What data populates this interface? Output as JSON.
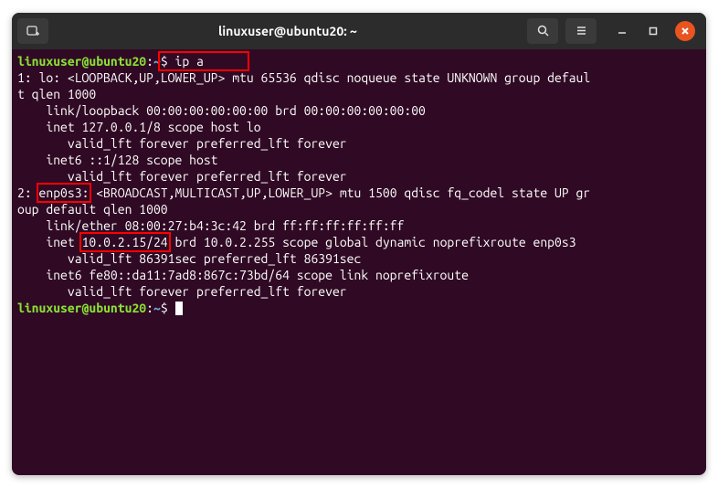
{
  "window": {
    "title": "linuxuser@ubuntu20: ~"
  },
  "prompt": {
    "user_host": "linuxuser@ubuntu20",
    "colon": ":",
    "path": "~",
    "symbol": "$"
  },
  "command": "ip a",
  "output": {
    "l1": "1: lo: <LOOPBACK,UP,LOWER_UP> mtu 65536 qdisc noqueue state UNKNOWN group defaul",
    "l2": "t qlen 1000",
    "l3": "    link/loopback 00:00:00:00:00:00 brd 00:00:00:00:00:00",
    "l4": "    inet 127.0.0.1/8 scope host lo",
    "l5": "       valid_lft forever preferred_lft forever",
    "l6": "    inet6 ::1/128 scope host ",
    "l7": "       valid_lft forever preferred_lft forever",
    "l8a": "2: ",
    "l8b": "enp0s3:",
    "l8c": " <BROADCAST,MULTICAST,UP,LOWER_UP> mtu 1500 qdisc fq_codel state UP gr",
    "l9": "oup default qlen 1000",
    "l10": "    link/ether 08:00:27:b4:3c:42 brd ff:ff:ff:ff:ff:ff",
    "l11a": "    inet ",
    "l11b": "10.0.2.15/24",
    "l11c": " brd 10.0.2.255 scope global dynamic noprefixroute enp0s3",
    "l12": "       valid_lft 86391sec preferred_lft 86391sec",
    "l13": "    inet6 fe80::da11:7ad8:867c:73bd/64 scope link noprefixroute ",
    "l14": "       valid_lft forever preferred_lft forever"
  }
}
